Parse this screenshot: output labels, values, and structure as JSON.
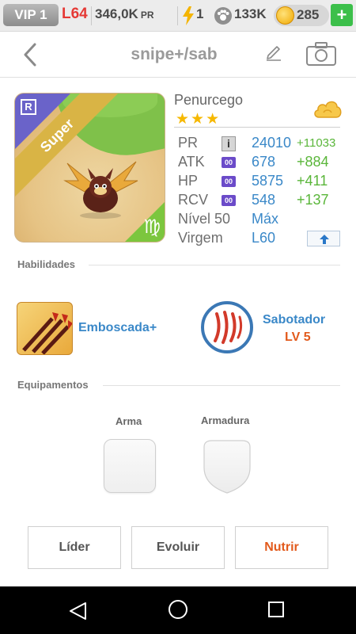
{
  "topbar": {
    "vip": "VIP 1",
    "level": "L64",
    "power": "346,0K",
    "power_unit": "PR",
    "energy": "1",
    "paws": "133K",
    "coins": "285",
    "plus": "+"
  },
  "header": {
    "title": "snipe+/sab"
  },
  "monster": {
    "name": "Penurcego",
    "stars": "★★★",
    "rarity_letter": "R",
    "tier_ribbon": "Super",
    "zodiac_glyph": "♍",
    "stats": {
      "pr": {
        "label": "PR",
        "value": "24010",
        "bonus": "+11033"
      },
      "atk": {
        "label": "ATK",
        "value": "678",
        "bonus": "+884"
      },
      "hp": {
        "label": "HP",
        "value": "5875",
        "bonus": "+411"
      },
      "rcv": {
        "label": "RCV",
        "value": "548",
        "bonus": "+137"
      },
      "level": {
        "label": "Nível 50",
        "value": "Máx"
      },
      "zodiac": {
        "label": "Virgem",
        "value": "L60"
      }
    },
    "info_icon_text": "i",
    "boost_icon_text": "00"
  },
  "skills": {
    "header": "Habilidades",
    "active_name": "Emboscada+",
    "passive_name": "Sabotador",
    "passive_level": "LV 5"
  },
  "equipment": {
    "header": "Equipamentos",
    "weapon_label": "Arma",
    "armor_label": "Armadura"
  },
  "actions": {
    "leader": "Líder",
    "evolve": "Evoluir",
    "feed": "Nutrir"
  },
  "colors": {
    "stat_value": "#3a88c8",
    "stat_bonus": "#5ab63a",
    "accent_orange": "#e25a1c",
    "level_red": "#e53935",
    "plus_green": "#3cbf4a"
  }
}
